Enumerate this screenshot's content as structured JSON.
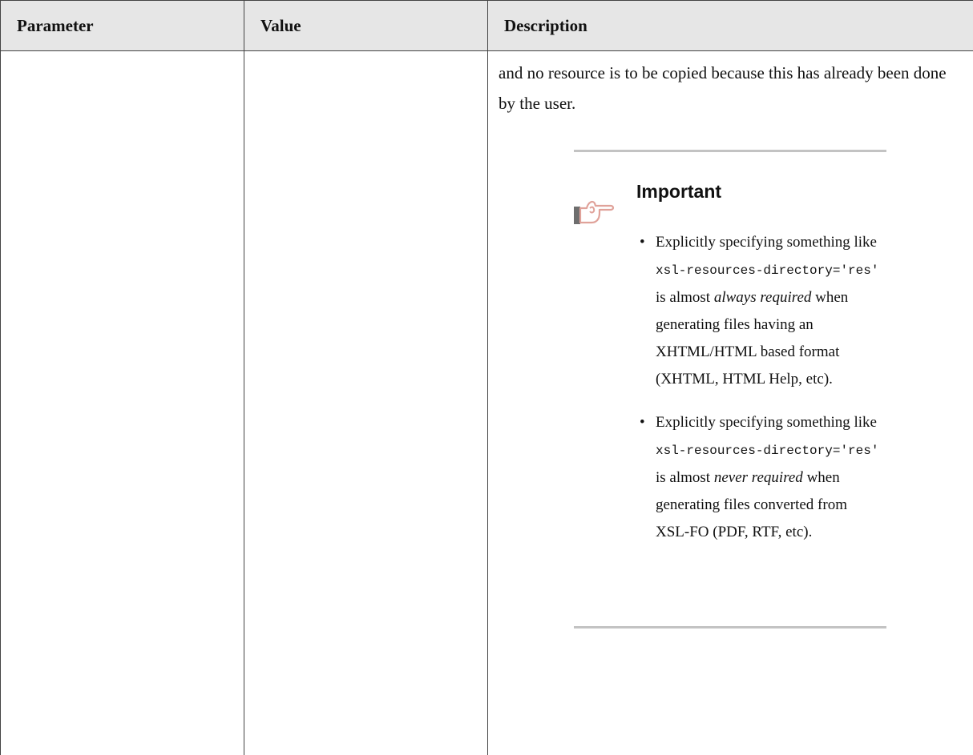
{
  "table": {
    "headers": {
      "parameter": "Parameter",
      "value": "Value",
      "description": "Description"
    }
  },
  "description": {
    "lead_text": "and no resource is to be copied because this has already been done by the user."
  },
  "admonition": {
    "icon": "pointing-hand-icon",
    "title": "Important",
    "items": [
      {
        "text_before": "Explicitly specifying something like",
        "code": "xsl-resources-directory='res'",
        "text_middle": "is almost",
        "emphasis": "always required",
        "text_after": "when generating files having an XHTML/HTML based format (XHTML, HTML Help, etc)."
      },
      {
        "text_before": "Explicitly specifying something like",
        "code": "xsl-resources-directory='res'",
        "text_middle": "is almost",
        "emphasis": "never required",
        "text_after": "when generating files converted from XSL-FO (PDF, RTF, etc)."
      }
    ]
  }
}
